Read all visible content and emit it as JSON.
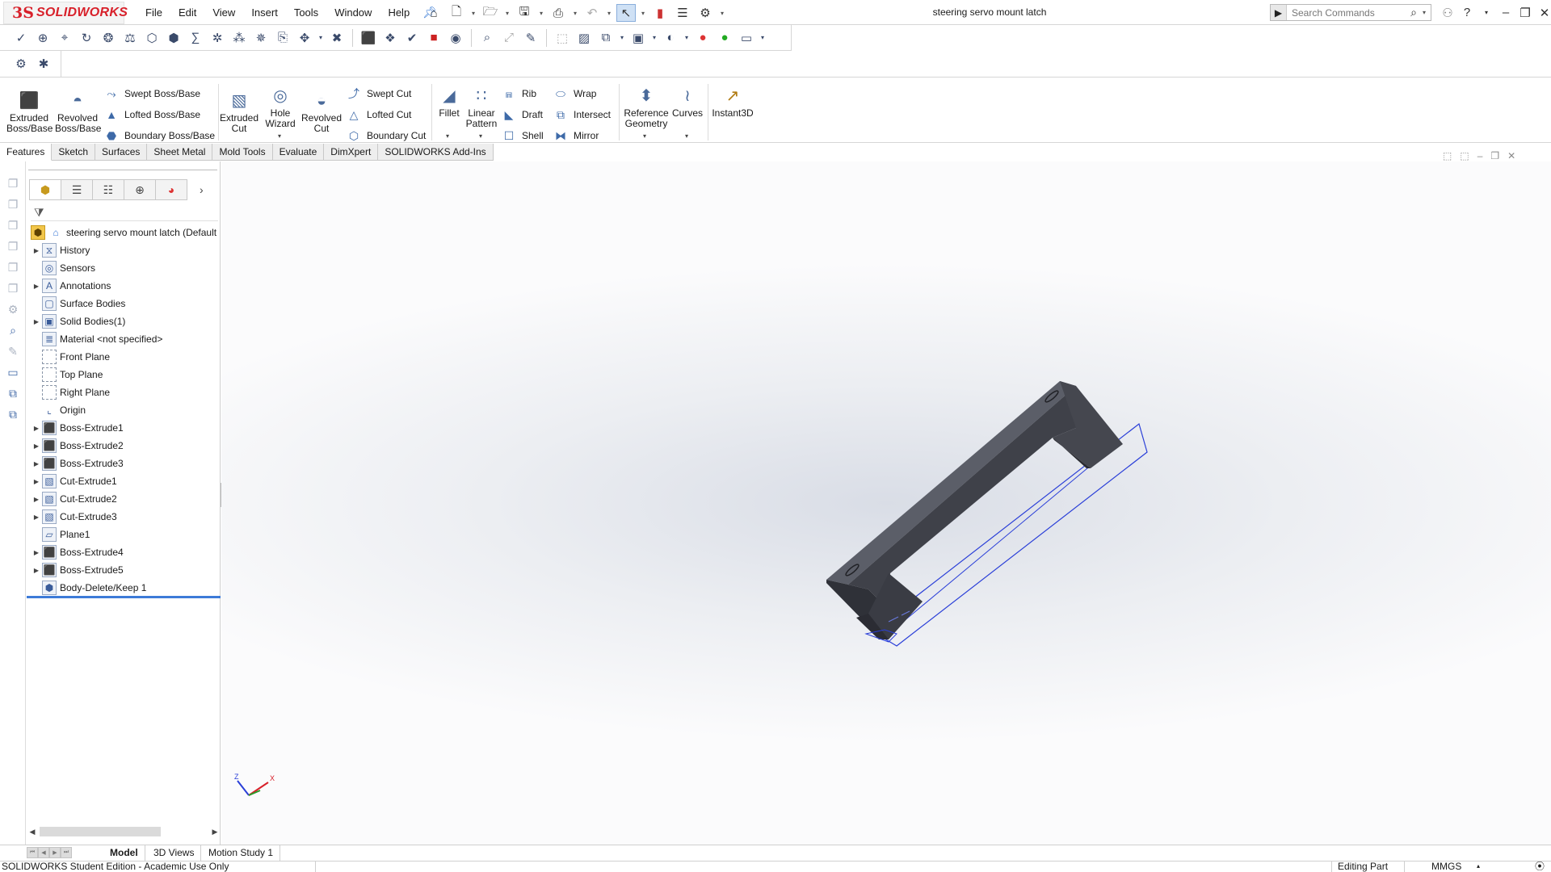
{
  "app": {
    "brand_prefix": "3S",
    "brand_name": "SOLIDWORKS"
  },
  "menu": [
    "File",
    "Edit",
    "View",
    "Insert",
    "Tools",
    "Window",
    "Help"
  ],
  "window": {
    "document_title": "steering servo mount latch"
  },
  "search": {
    "placeholder": "Search Commands"
  },
  "ribbon": {
    "extruded_boss": "Extruded Boss/Base",
    "revolved_boss": "Revolved Boss/Base",
    "swept_boss": "Swept Boss/Base",
    "lofted_boss": "Lofted Boss/Base",
    "boundary_boss": "Boundary Boss/Base",
    "extruded_cut": "Extruded Cut",
    "hole_wizard": "Hole Wizard",
    "revolved_cut": "Revolved Cut",
    "swept_cut": "Swept Cut",
    "lofted_cut": "Lofted Cut",
    "boundary_cut": "Boundary Cut",
    "fillet": "Fillet",
    "linear_pattern": "Linear Pattern",
    "rib": "Rib",
    "draft": "Draft",
    "shell": "Shell",
    "wrap": "Wrap",
    "intersect": "Intersect",
    "mirror": "Mirror",
    "reference_geometry": "Reference Geometry",
    "curves": "Curves",
    "instant3d": "Instant3D"
  },
  "cm_tabs": [
    "Features",
    "Sketch",
    "Surfaces",
    "Sheet Metal",
    "Mold Tools",
    "Evaluate",
    "DimXpert",
    "SOLIDWORKS Add-Ins"
  ],
  "tree": {
    "root": "steering servo mount latch  (Default",
    "items": [
      {
        "label": "History",
        "icon": "history-icon",
        "expandable": true
      },
      {
        "label": "Sensors",
        "icon": "sensors-icon",
        "expandable": false
      },
      {
        "label": "Annotations",
        "icon": "annotations-icon",
        "expandable": true
      },
      {
        "label": "Surface Bodies",
        "icon": "surface-bodies-icon",
        "expandable": false
      },
      {
        "label": "Solid Bodies(1)",
        "icon": "solid-bodies-icon",
        "expandable": true
      },
      {
        "label": "Material <not specified>",
        "icon": "material-icon",
        "expandable": false
      },
      {
        "label": "Front Plane",
        "icon": "plane-icon",
        "expandable": false
      },
      {
        "label": "Top Plane",
        "icon": "plane-icon",
        "expandable": false
      },
      {
        "label": "Right Plane",
        "icon": "plane-icon",
        "expandable": false
      },
      {
        "label": "Origin",
        "icon": "origin-icon",
        "expandable": false
      },
      {
        "label": "Boss-Extrude1",
        "icon": "boss-extrude-icon",
        "expandable": true
      },
      {
        "label": "Boss-Extrude2",
        "icon": "boss-extrude-icon",
        "expandable": true
      },
      {
        "label": "Boss-Extrude3",
        "icon": "boss-extrude-icon",
        "expandable": true
      },
      {
        "label": "Cut-Extrude1",
        "icon": "cut-extrude-icon",
        "expandable": true
      },
      {
        "label": "Cut-Extrude2",
        "icon": "cut-extrude-icon",
        "expandable": true
      },
      {
        "label": "Cut-Extrude3",
        "icon": "cut-extrude-icon",
        "expandable": true
      },
      {
        "label": "Plane1",
        "icon": "plane1-icon",
        "expandable": false
      },
      {
        "label": "Boss-Extrude4",
        "icon": "boss-extrude-icon",
        "expandable": true
      },
      {
        "label": "Boss-Extrude5",
        "icon": "boss-extrude-icon",
        "expandable": true
      },
      {
        "label": "Body-Delete/Keep 1",
        "icon": "body-delete-icon",
        "expandable": false
      }
    ]
  },
  "bottom_tabs": [
    "Model",
    "3D Views",
    "Motion Study 1"
  ],
  "status": {
    "edition": "SOLIDWORKS Student Edition - Academic Use Only",
    "mode": "Editing Part",
    "units": "MMGS"
  },
  "triad": {
    "x": "X",
    "z": "Z"
  },
  "colors": {
    "model_face_top": "#5a5c66",
    "model_face_side": "#3e4048",
    "sketch_blue": "#1f3fdf",
    "selection_blue": "#3d7bd8",
    "brand_red": "#d8202a"
  }
}
